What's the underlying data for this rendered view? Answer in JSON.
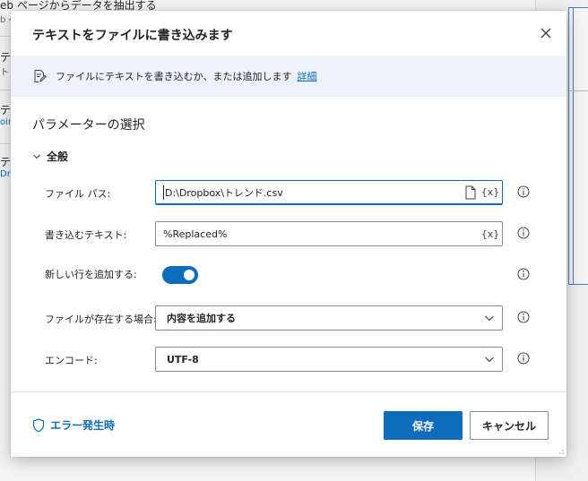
{
  "background": {
    "top_step_title": "eb ページからデータを抽出する",
    "top_step_sub": "b ペ",
    "steps": [
      {
        "title": "テス",
        "sub": "ト"
      },
      {
        "title": "テス",
        "sub": "oin"
      },
      {
        "title": "テス",
        "sub": "Dr"
      }
    ]
  },
  "dialog": {
    "title": "テキストをファイルに書き込みます",
    "info": {
      "text": "ファイルにテキストを書き込むか、または追加します",
      "link": "詳細"
    },
    "section_heading": "パラメーターの選択",
    "group_label": "全般",
    "fields": {
      "file_path": {
        "label": "ファイル パス:",
        "value": "D:\\Dropbox\\トレンド.csv",
        "var_button": "{x}"
      },
      "text": {
        "label": "書き込むテキスト:",
        "value": "%Replaced%",
        "var_button": "{x}"
      },
      "newline": {
        "label": "新しい行を追加する:",
        "enabled": true
      },
      "if_exists": {
        "label": "ファイルが存在する場合:",
        "value": "内容を追加する"
      },
      "encoding": {
        "label": "エンコード:",
        "value": "UTF-8"
      }
    },
    "footer": {
      "error_link": "エラー発生時",
      "save": "保存",
      "cancel": "キャンセル"
    }
  },
  "colors": {
    "accent": "#0f6cbd",
    "info_bar_bg": "#edf3fb"
  }
}
